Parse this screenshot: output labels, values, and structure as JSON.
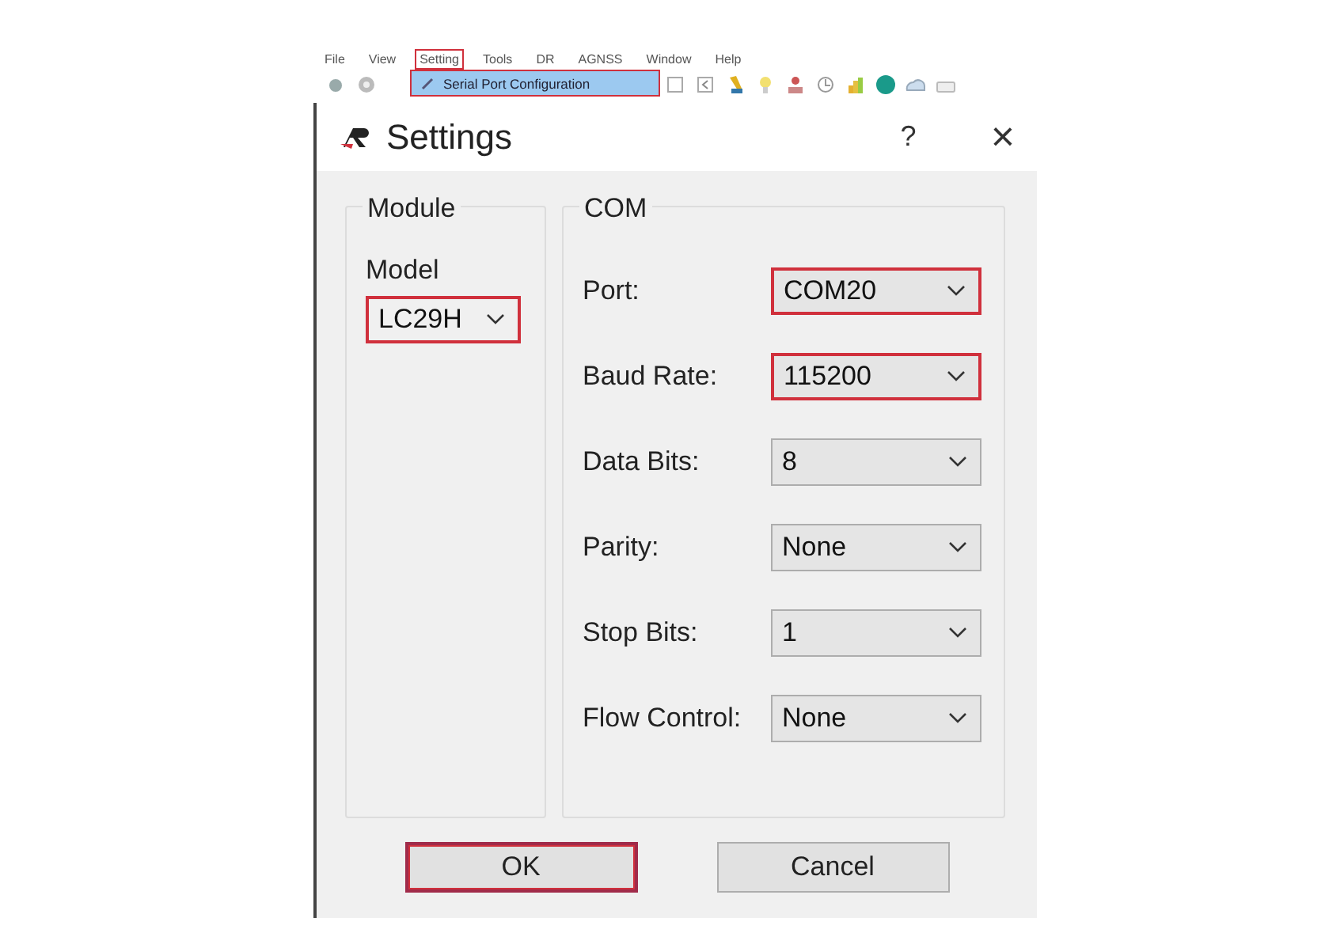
{
  "menu_bar": [
    {
      "label": "File",
      "highlighted": false
    },
    {
      "label": "View",
      "highlighted": false
    },
    {
      "label": "Setting",
      "highlighted": true
    },
    {
      "label": "Tools",
      "highlighted": false
    },
    {
      "label": "DR",
      "highlighted": false
    },
    {
      "label": "AGNSS",
      "highlighted": false
    },
    {
      "label": "Window",
      "highlighted": false
    },
    {
      "label": "Help",
      "highlighted": false
    }
  ],
  "open_menu": {
    "items": [
      {
        "label": "Serial Port Configuration",
        "highlighted": true
      }
    ]
  },
  "dialog": {
    "title": "Settings",
    "help": "?",
    "close": "×",
    "module_group": {
      "title": "Module",
      "label": "Model",
      "field": {
        "value": "LC29H",
        "highlighted": true
      }
    },
    "com_group": {
      "title": "COM",
      "fields": [
        {
          "label": "Port:",
          "value": "COM20",
          "highlighted": true
        },
        {
          "label": "Baud Rate:",
          "value": "115200",
          "highlighted": true
        },
        {
          "label": "Data Bits:",
          "value": "8",
          "highlighted": false
        },
        {
          "label": "Parity:",
          "value": "None",
          "highlighted": false
        },
        {
          "label": "Stop Bits:",
          "value": "1",
          "highlighted": false
        },
        {
          "label": "Flow Control:",
          "value": "None",
          "highlighted": false
        }
      ]
    },
    "buttons": [
      {
        "label": "OK",
        "highlighted": true
      },
      {
        "label": "Cancel",
        "highlighted": false
      }
    ]
  }
}
